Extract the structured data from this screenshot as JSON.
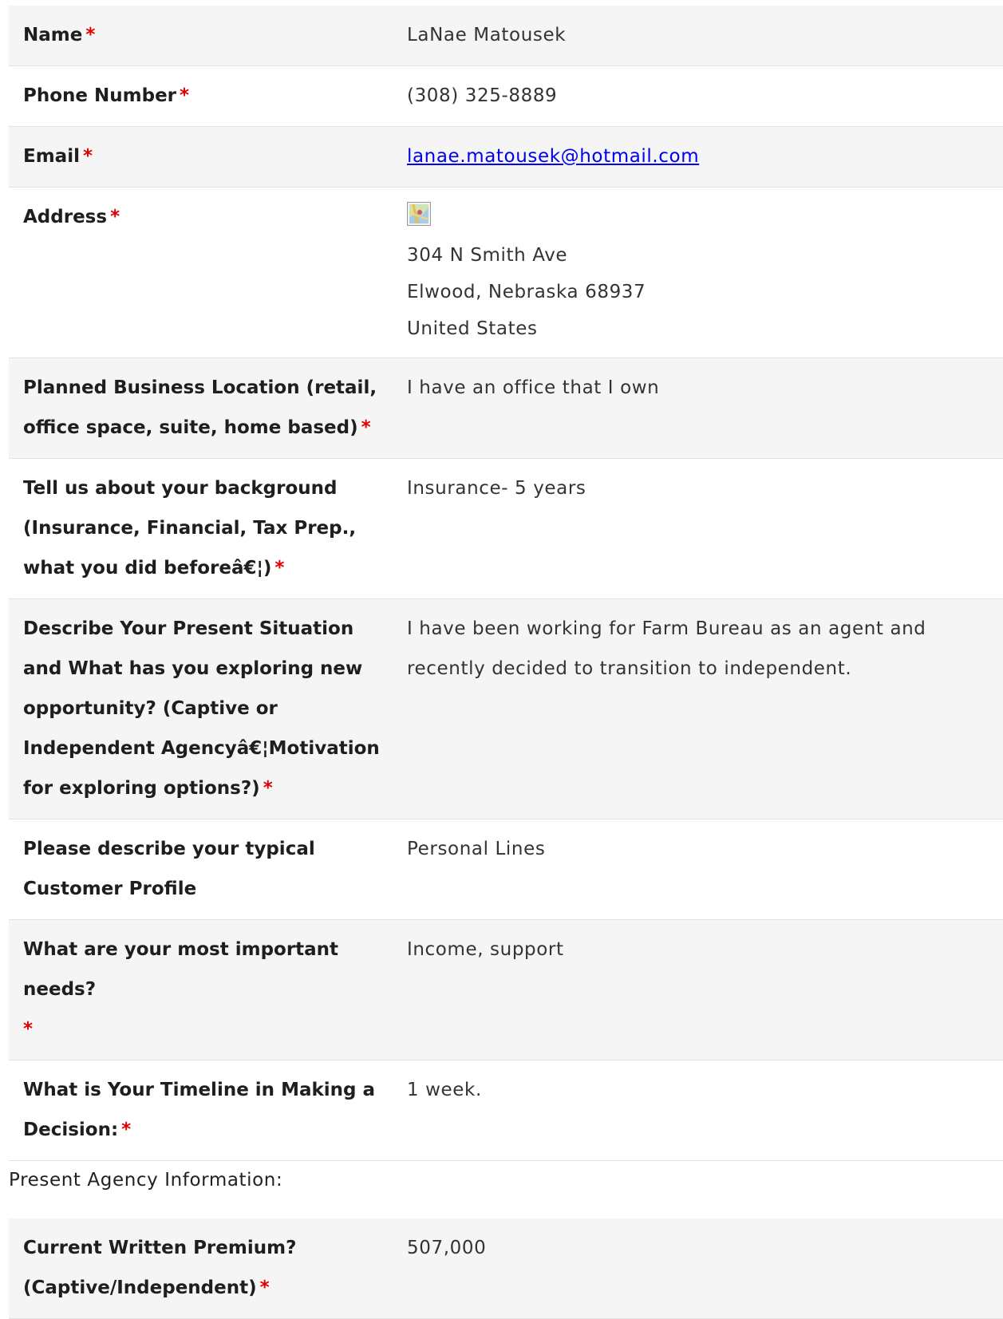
{
  "fields": [
    {
      "label": "Name",
      "required": true,
      "value": "LaNae Matousek"
    },
    {
      "label": "Phone Number",
      "required": true,
      "value": "(308) 325-8889"
    },
    {
      "label": "Email",
      "required": true,
      "value": "lanae.matousek@hotmail.com"
    },
    {
      "label": "Address",
      "required": true,
      "address": {
        "street": "304 N Smith Ave",
        "city_line": "Elwood, Nebraska 68937",
        "country": "United States"
      }
    },
    {
      "label": "Planned Business Location (retail, office space, suite, home based)",
      "required": true,
      "value": "I have an office that I own"
    },
    {
      "label": "Tell us about your background (Insurance, Financial, Tax Prep., what you did beforeâ€¦)",
      "required": true,
      "value": "Insurance- 5 years"
    },
    {
      "label": "Describe Your Present Situation and What has you exploring new opportunity? (Captive or Independent Agencyâ€¦Motivation for exploring options?)",
      "required": true,
      "value": "I have been working for Farm Bureau as an agent and recently decided to transition to independent."
    },
    {
      "label": "Please describe your typical Customer Profile",
      "required": false,
      "value": "Personal Lines"
    },
    {
      "label": "What are your most important needs?",
      "required": true,
      "value": "Income, support"
    },
    {
      "label": "What is Your Timeline in Making a Decision:",
      "required": true,
      "value": "1 week."
    }
  ],
  "required_marker": "*",
  "section2": {
    "heading": "Present Agency Information:",
    "fields": [
      {
        "label": "Current Written Premium? (Captive/Independent)",
        "required": true,
        "value": "507,000"
      }
    ]
  },
  "icons": {
    "address_map": "map-icon"
  }
}
